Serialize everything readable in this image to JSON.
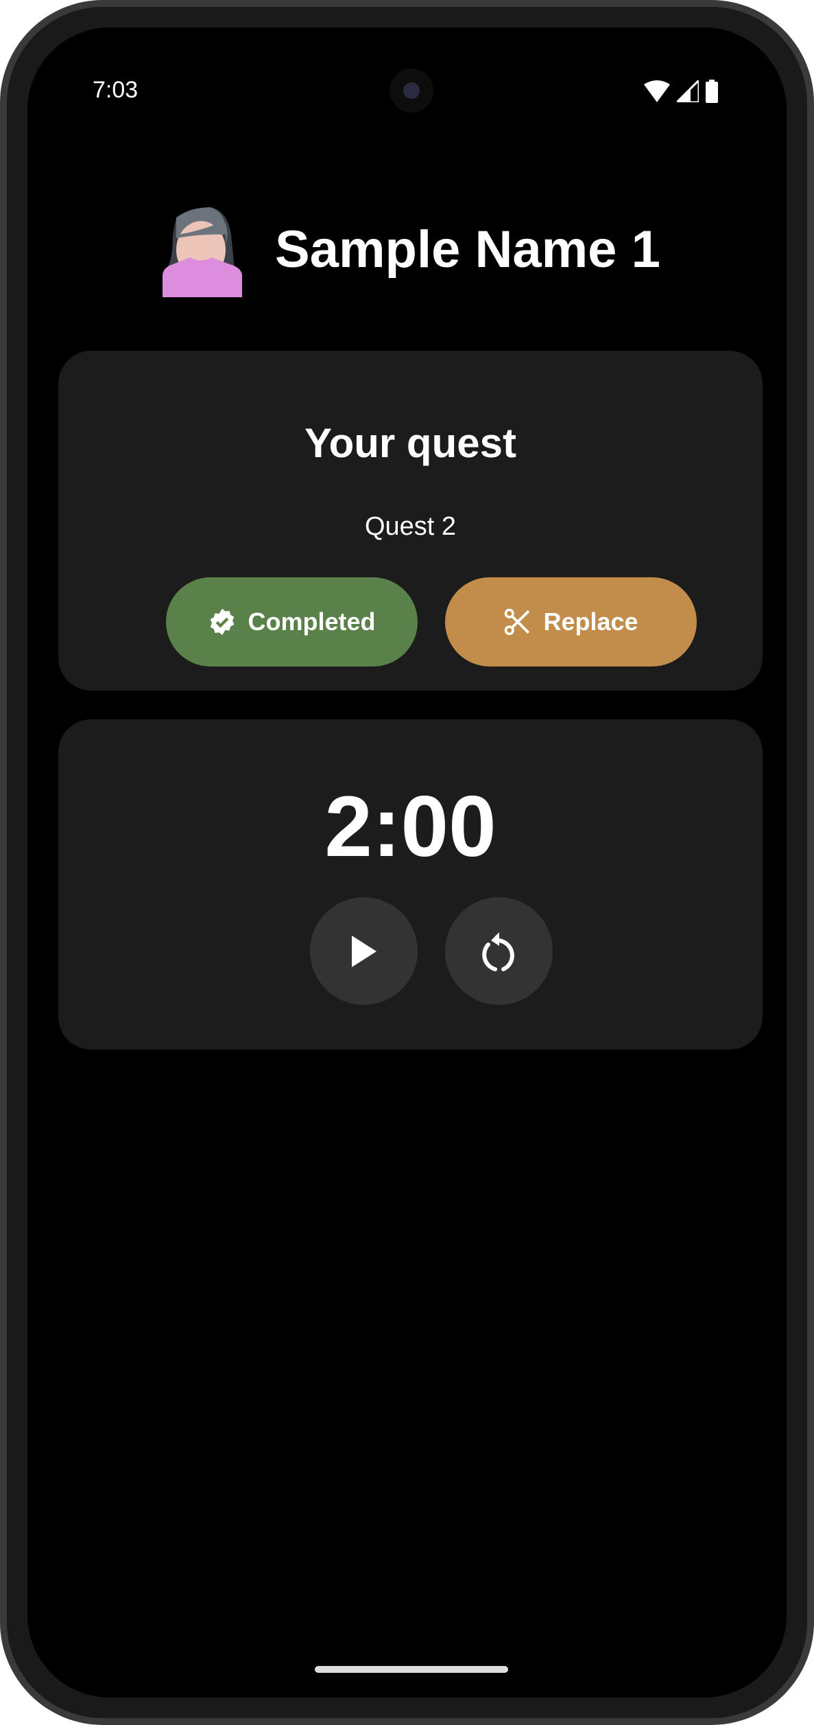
{
  "status_bar": {
    "time": "7:03",
    "icons": [
      "wifi-icon",
      "signal-icon",
      "battery-icon"
    ]
  },
  "profile": {
    "name": "Sample Name 1",
    "avatar": "woman-avatar"
  },
  "quest_card": {
    "title": "Your quest",
    "quest": "Quest 2",
    "completed_label": "Completed",
    "replace_label": "Replace"
  },
  "timer_card": {
    "time": "2:00",
    "play_icon": "play-icon",
    "reset_icon": "reset-icon"
  },
  "colors": {
    "background": "#000000",
    "card": "#1c1c1c",
    "completed": "#5a8149",
    "replace": "#c28c4a",
    "circle_button": "#333333"
  }
}
